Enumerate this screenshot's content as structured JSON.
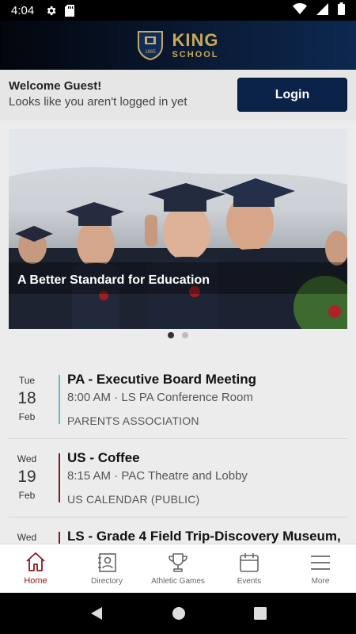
{
  "status_bar": {
    "time": "4:04",
    "icons": [
      "gear-icon",
      "sd-card-icon",
      "wifi-icon",
      "signal-icon",
      "battery-icon"
    ]
  },
  "header": {
    "logo_line1": "KING",
    "logo_line2": "SCHOOL",
    "crest_year": "1865"
  },
  "welcome": {
    "title": "Welcome Guest!",
    "subtitle": "Looks like you aren't logged in yet",
    "login_label": "Login"
  },
  "hero": {
    "caption": "A Better Standard for Education",
    "slide_count": 2,
    "active_slide": 1
  },
  "events": [
    {
      "dow": "Tue",
      "day": "18",
      "month": "Feb",
      "title": "PA - Executive Board Meeting",
      "meta": "8:00 AM · LS PA Conference Room",
      "calendar": "PARENTS ASSOCIATION",
      "accent": "#6ab7c9"
    },
    {
      "dow": "Wed",
      "day": "19",
      "month": "Feb",
      "title": "US - Coffee",
      "meta": "8:15 AM · PAC Theatre and Lobby",
      "calendar": "US CALENDAR (PUBLIC)",
      "accent": "#7a1b1b"
    },
    {
      "dow": "Wed",
      "day": "",
      "month": "",
      "title": "LS - Grade 4 Field Trip-Discovery Museum,",
      "meta": "",
      "calendar": "",
      "accent": "#7a1b1b"
    }
  ],
  "tabs": [
    {
      "label": "Home",
      "icon": "home-icon",
      "active": true
    },
    {
      "label": "Directory",
      "icon": "directory-icon",
      "active": false
    },
    {
      "label": "Athletic Games",
      "icon": "trophy-icon",
      "active": false
    },
    {
      "label": "Events",
      "icon": "calendar-icon",
      "active": false
    },
    {
      "label": "More",
      "icon": "menu-icon",
      "active": false
    }
  ],
  "colors": {
    "brand_navy": "#0b2349",
    "brand_gold": "#c9a95a",
    "active_tab": "#8b1a1a"
  }
}
